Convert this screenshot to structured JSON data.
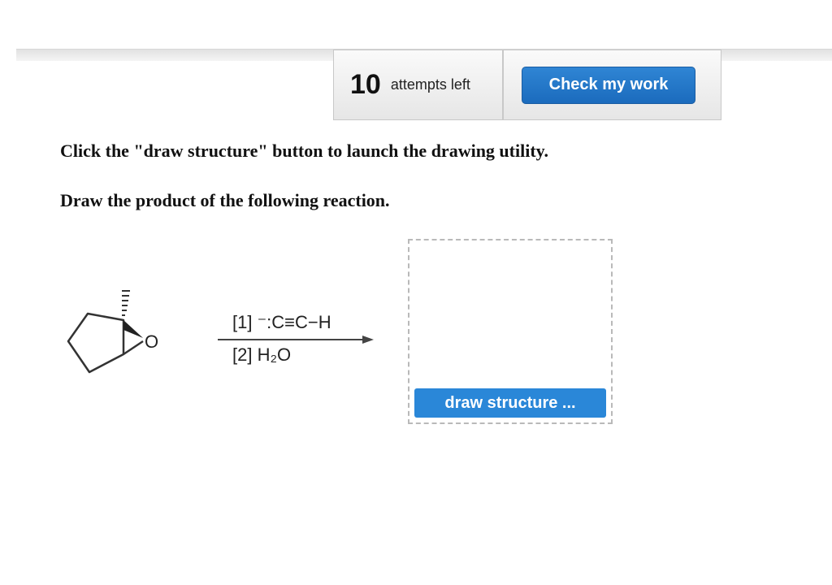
{
  "toolbar": {
    "attempts_count": "10",
    "attempts_label": "attempts left",
    "check_label": "Check my work"
  },
  "question": {
    "instruction_1": "Click the \"draw structure\" button to launch the drawing utility.",
    "instruction_2": "Draw the product of the following reaction."
  },
  "reaction": {
    "oxygen_label": "O",
    "reagent_1": "[1] ⁻:C≡C−H",
    "reagent_2": "[2] H₂O"
  },
  "answer": {
    "draw_button_label": "draw structure ..."
  },
  "colors": {
    "accent": "#1b6bbd",
    "draw_button": "#2a87d8"
  }
}
